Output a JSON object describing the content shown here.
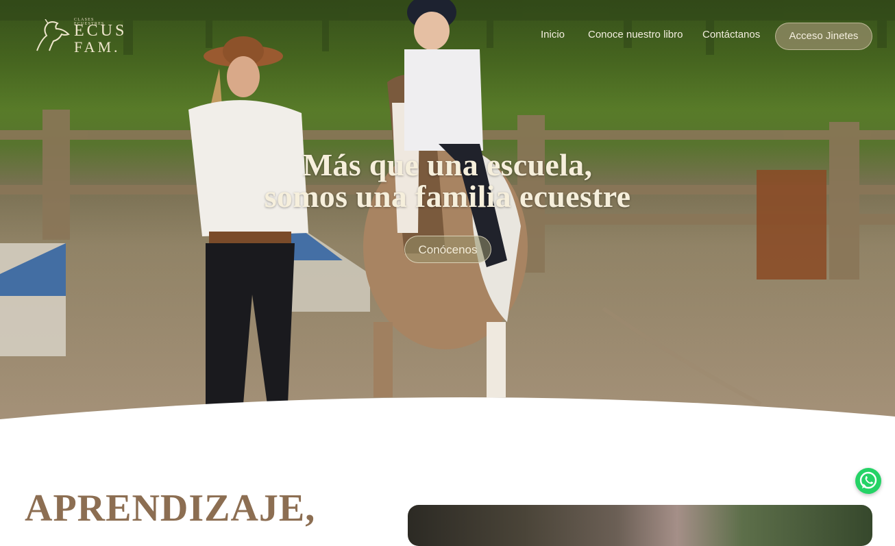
{
  "brand": {
    "tagline": "CLASES ECUESTRES",
    "word1": "ECUS",
    "word2": "FAM."
  },
  "nav": {
    "inicio": "Inicio",
    "libro": "Conoce nuestro libro",
    "contacto": "Contáctanos",
    "acceso": "Acceso Jinetes"
  },
  "hero": {
    "title_line1": "Más que una escuela,",
    "title_line2": "somos una familia ecuestre",
    "cta": "Conócenos"
  },
  "section": {
    "title": "APRENDIZAJE,"
  },
  "icons": {
    "logo": "horse-logo-icon",
    "whatsapp": "whatsapp-icon"
  },
  "colors": {
    "accent_brown": "#8c6e52",
    "whatsapp_green": "#25d366"
  }
}
